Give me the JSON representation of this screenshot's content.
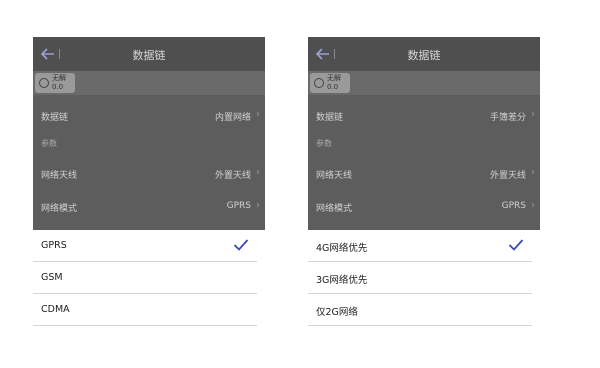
{
  "colors": {
    "accent": "#3a47b8",
    "overlay": "#5d5d5d"
  },
  "screens": [
    {
      "header": {
        "title": "数据链",
        "back_icon": "arrow-left-icon"
      },
      "status": {
        "line1": "无解",
        "line2": "0.0"
      },
      "rows": {
        "datalink": {
          "label": "数据链",
          "value": "内置网络"
        },
        "section": "参数",
        "antenna": {
          "label": "网络天线",
          "value": "外置天线"
        },
        "mode": {
          "label": "网络模式",
          "value": "GPRS"
        }
      },
      "options": [
        {
          "label": "GPRS",
          "selected": true
        },
        {
          "label": "GSM",
          "selected": false
        },
        {
          "label": "CDMA",
          "selected": false
        }
      ]
    },
    {
      "header": {
        "title": "数据链",
        "back_icon": "arrow-left-icon"
      },
      "status": {
        "line1": "无解",
        "line2": "0.0"
      },
      "rows": {
        "datalink": {
          "label": "数据链",
          "value": "手簿差分"
        },
        "section": "参数",
        "antenna": {
          "label": "网络天线",
          "value": "外置天线"
        },
        "mode": {
          "label": "网络模式",
          "value": "GPRS"
        }
      },
      "options": [
        {
          "label": "4G网络优先",
          "selected": true
        },
        {
          "label": "3G网络优先",
          "selected": false
        },
        {
          "label": "仅2G网络",
          "selected": false
        }
      ]
    }
  ]
}
